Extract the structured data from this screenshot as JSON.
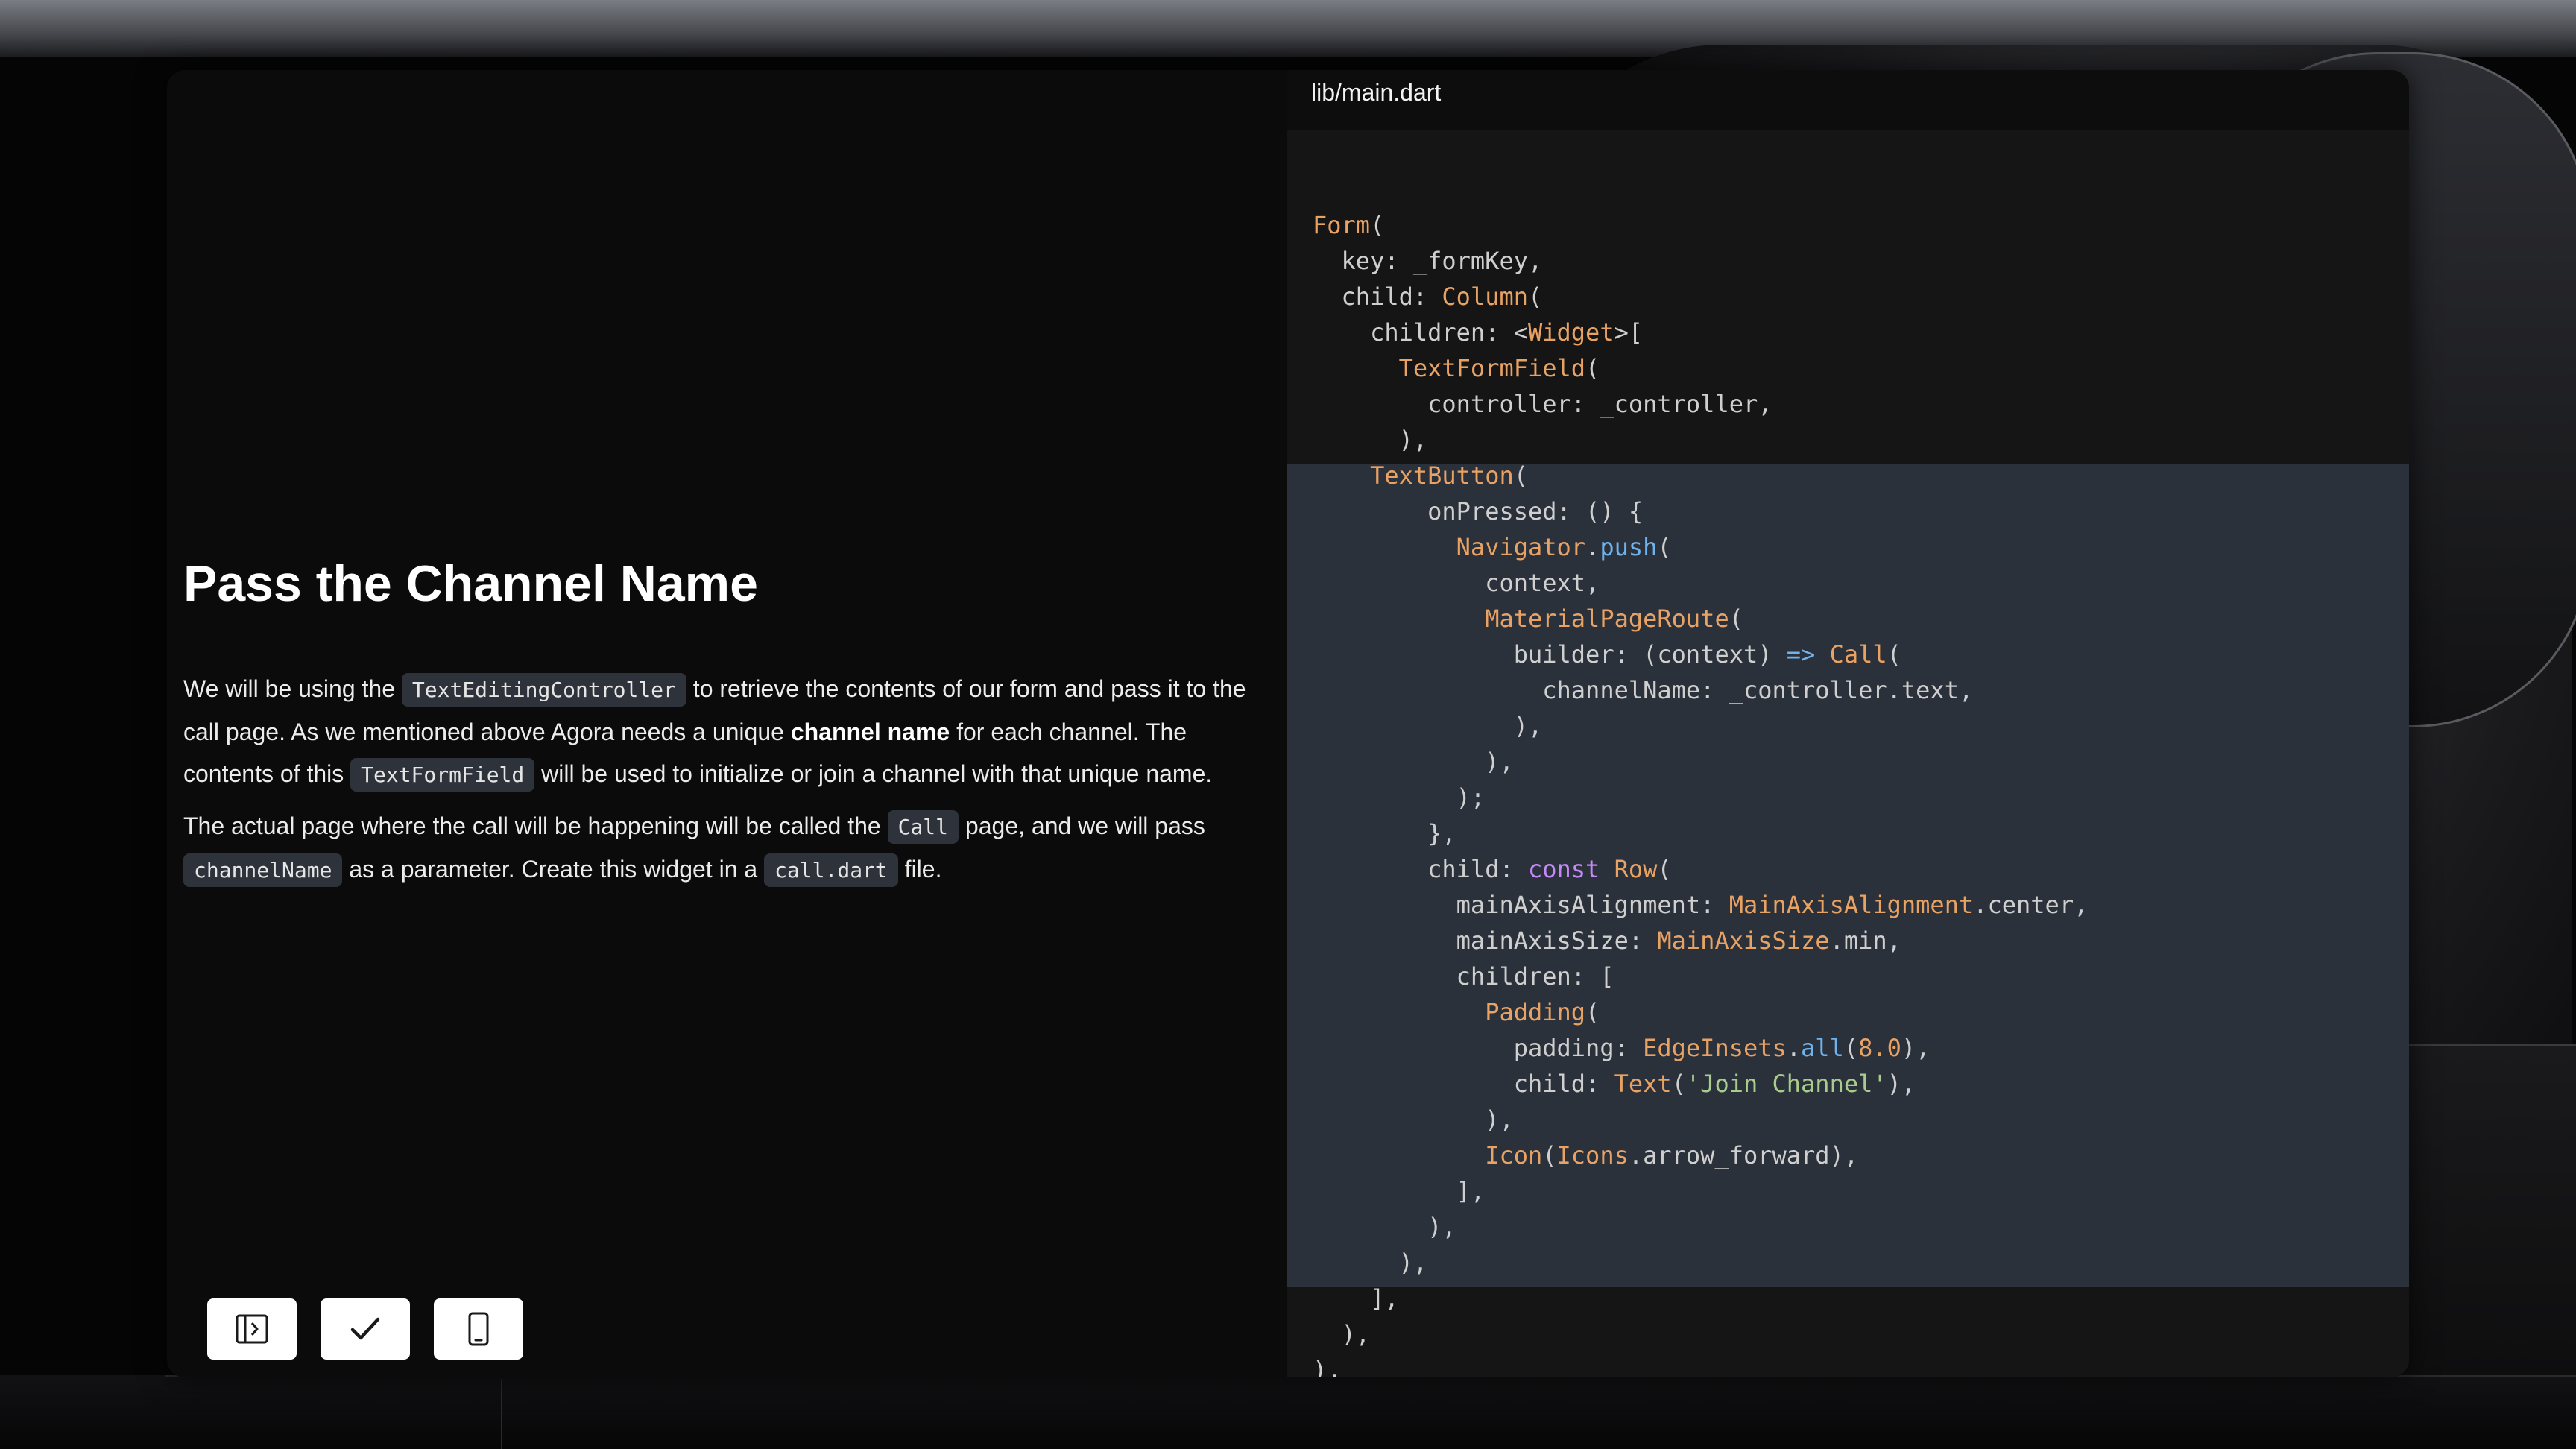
{
  "file": {
    "name": "lib/main.dart"
  },
  "lesson": {
    "title": "Pass the Channel Name",
    "p1": {
      "t1": "We will be using the ",
      "c1": "TextEditingController",
      "t2": " to retrieve the contents of our form and pass it to the call page. As we mentioned above Agora needs a unique ",
      "b1": "channel name",
      "t3": " for each channel. The contents of this ",
      "c2": "TextFormField",
      "t4": " will be used to initialize or join a channel with that unique name."
    },
    "p2": {
      "t1": "The actual page where the call will be happening will be called the ",
      "c1": "Call",
      "t2": " page, and we will pass ",
      "c2": "channelName",
      "t3": " as a parameter. Create this widget in a ",
      "c3": "call.dart",
      "t4": " file."
    }
  },
  "code": {
    "highlight_start_line": 8,
    "highlight_end_line": 30,
    "lines": [
      [
        [
          "Form",
          "type"
        ],
        [
          "(",
          ""
        ]
      ],
      [
        [
          "  key: _formKey,",
          ""
        ]
      ],
      [
        [
          "  child: ",
          ""
        ],
        [
          "Column",
          "type"
        ],
        [
          "(",
          ""
        ]
      ],
      [
        [
          "    children: <",
          ""
        ],
        [
          "Widget",
          "type"
        ],
        [
          ">[",
          ""
        ]
      ],
      [
        [
          "      ",
          ""
        ],
        [
          "TextFormField",
          "type"
        ],
        [
          "(",
          ""
        ]
      ],
      [
        [
          "        controller: _controller,",
          ""
        ]
      ],
      [
        [
          "      ),",
          ""
        ]
      ],
      [
        [
          "    ",
          ""
        ],
        [
          "TextButton",
          "type"
        ],
        [
          "(",
          ""
        ]
      ],
      [
        [
          "        onPressed: () {",
          ""
        ]
      ],
      [
        [
          "          ",
          ""
        ],
        [
          "Navigator",
          "type"
        ],
        [
          ".",
          ""
        ],
        [
          "push",
          "fn"
        ],
        [
          "(",
          ""
        ]
      ],
      [
        [
          "            context,",
          ""
        ]
      ],
      [
        [
          "            ",
          ""
        ],
        [
          "MaterialPageRoute",
          "type"
        ],
        [
          "(",
          ""
        ]
      ],
      [
        [
          "              builder: (context) ",
          ""
        ],
        [
          "=>",
          "fn"
        ],
        [
          " ",
          ""
        ],
        [
          "Call",
          "type"
        ],
        [
          "(",
          ""
        ]
      ],
      [
        [
          "                channelName: _controller.text,",
          ""
        ]
      ],
      [
        [
          "              ),",
          ""
        ]
      ],
      [
        [
          "            ),",
          ""
        ]
      ],
      [
        [
          "          );",
          ""
        ]
      ],
      [
        [
          "        },",
          ""
        ]
      ],
      [
        [
          "        child: ",
          ""
        ],
        [
          "const",
          "kw"
        ],
        [
          " ",
          ""
        ],
        [
          "Row",
          "type"
        ],
        [
          "(",
          ""
        ]
      ],
      [
        [
          "          mainAxisAlignment: ",
          ""
        ],
        [
          "MainAxisAlignment",
          "type"
        ],
        [
          ".center,",
          ""
        ]
      ],
      [
        [
          "          mainAxisSize: ",
          ""
        ],
        [
          "MainAxisSize",
          "type"
        ],
        [
          ".min,",
          ""
        ]
      ],
      [
        [
          "          children: [",
          ""
        ]
      ],
      [
        [
          "            ",
          ""
        ],
        [
          "Padding",
          "type"
        ],
        [
          "(",
          ""
        ]
      ],
      [
        [
          "              padding: ",
          ""
        ],
        [
          "EdgeInsets",
          "type"
        ],
        [
          ".",
          ""
        ],
        [
          "all",
          "fn"
        ],
        [
          "(",
          ""
        ],
        [
          "8.0",
          "num"
        ],
        [
          "),",
          ""
        ]
      ],
      [
        [
          "              child: ",
          ""
        ],
        [
          "Text",
          "type"
        ],
        [
          "(",
          ""
        ],
        [
          "'Join Channel'",
          "str"
        ],
        [
          "),",
          ""
        ]
      ],
      [
        [
          "            ),",
          ""
        ]
      ],
      [
        [
          "            ",
          ""
        ],
        [
          "Icon",
          "type"
        ],
        [
          "(",
          ""
        ],
        [
          "Icons",
          "type"
        ],
        [
          ".arrow_forward),",
          ""
        ]
      ],
      [
        [
          "          ],",
          ""
        ]
      ],
      [
        [
          "        ),",
          ""
        ]
      ],
      [
        [
          "      ),",
          ""
        ]
      ],
      [
        [
          "    ],",
          ""
        ]
      ],
      [
        [
          "  ),",
          ""
        ]
      ],
      [
        [
          "),",
          ""
        ]
      ]
    ]
  },
  "toolbar": {
    "buttons": [
      {
        "icon": "toggle-sidebar-icon"
      },
      {
        "icon": "check-icon"
      },
      {
        "icon": "phone-preview-icon"
      }
    ]
  }
}
